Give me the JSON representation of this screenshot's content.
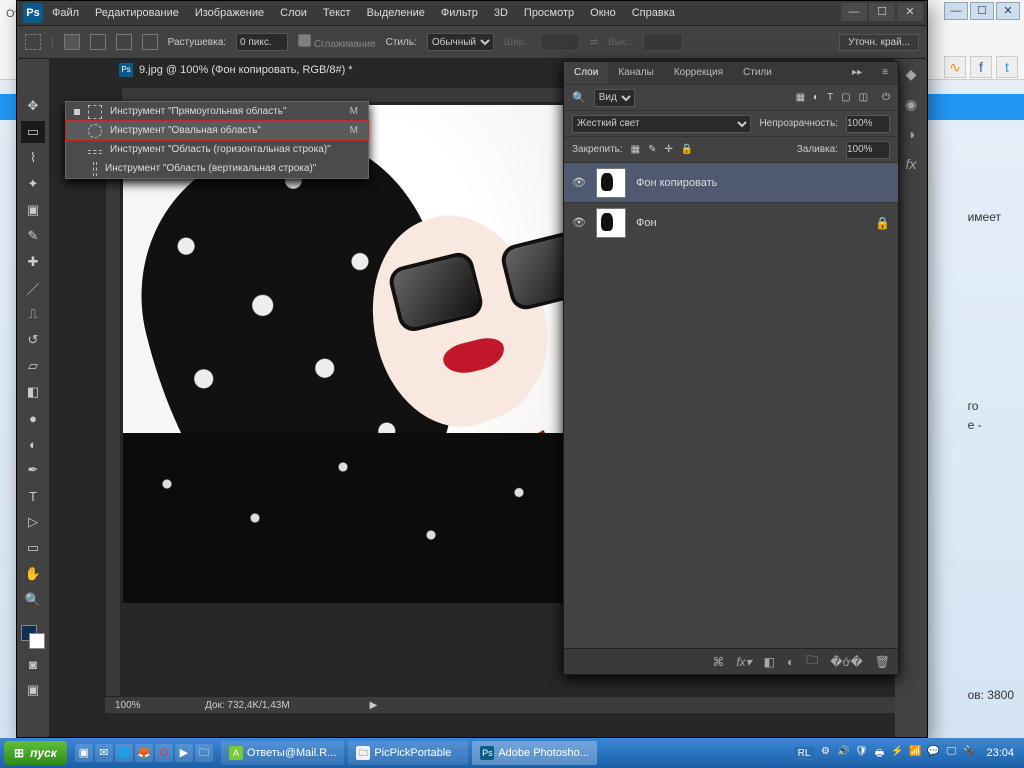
{
  "menubar": {
    "items": [
      "Файл",
      "Редактирование",
      "Изображение",
      "Слои",
      "Текст",
      "Выделение",
      "Фильтр",
      "3D",
      "Просмотр",
      "Окно",
      "Справка"
    ]
  },
  "optionsbar": {
    "feather_label": "Растушевка:",
    "feather_value": "0 пикс.",
    "antialias_label": "Сглаживание",
    "style_label": "Стиль:",
    "style_value": "Обычный",
    "width_label": "Шир.:",
    "height_label": "Выс.:",
    "refine_label": "Уточн. край..."
  },
  "document": {
    "tab_title": "9.jpg @ 100% (Фон копировать, RGB/8#) *",
    "zoom": "100%",
    "doc_info": "Док: 732,4K/1,43M"
  },
  "tool_flyout": {
    "items": [
      {
        "label": "Инструмент \"Прямоугольная область\"",
        "shortcut": "M",
        "active": true
      },
      {
        "label": "Инструмент \"Овальная область\"",
        "shortcut": "M",
        "highlighted": true
      },
      {
        "label": "Инструмент \"Область (горизонтальная строка)\"",
        "shortcut": ""
      },
      {
        "label": "Инструмент \"Область (вертикальная строка)\"",
        "shortcut": ""
      }
    ]
  },
  "layers_panel": {
    "tabs": [
      "Слои",
      "Каналы",
      "Коррекция",
      "Стили"
    ],
    "active_tab": 0,
    "filter_label": "Вид",
    "blend_mode": "Жесткий свет",
    "opacity_label": "Непрозрачность:",
    "opacity_value": "100%",
    "lock_label": "Закрепить:",
    "fill_label": "Заливка:",
    "fill_value": "100%",
    "layers": [
      {
        "name": "Фон копировать",
        "selected": true,
        "locked": false
      },
      {
        "name": "Фон",
        "selected": false,
        "locked": true
      }
    ],
    "footer_icons": [
      "link",
      "fx",
      "mask",
      "adjust",
      "group",
      "new",
      "trash"
    ]
  },
  "side_text": {
    "l1": "имеет",
    "l2": "го",
    "l3": "е -",
    "l4": "ов: 3800"
  },
  "taskbar": {
    "start": "пуск",
    "tasks": [
      {
        "label": "Ответы@Mail.R...",
        "active": false
      },
      {
        "label": "PicPickPortable",
        "active": false
      },
      {
        "label": "Adobe Photosho...",
        "active": true
      }
    ],
    "lang": "RL",
    "clock": "23:04"
  },
  "browser": {
    "tab_hint": "От"
  }
}
